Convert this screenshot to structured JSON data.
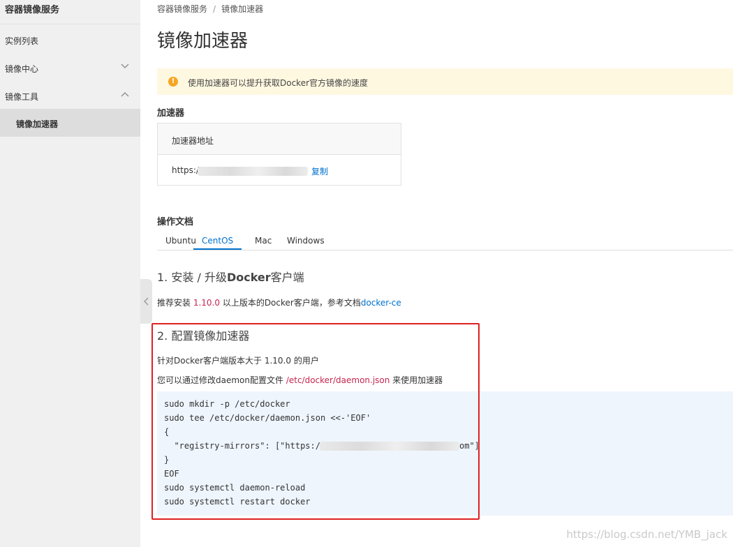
{
  "sidebar": {
    "title": "容器镜像服务",
    "items": [
      {
        "label": "实例列表"
      },
      {
        "label": "镜像中心",
        "expanded": false
      },
      {
        "label": "镜像工具",
        "expanded": true
      },
      {
        "label": "镜像加速器",
        "active": true
      }
    ]
  },
  "breadcrumb": {
    "root": "容器镜像服务",
    "separator": "/",
    "current": "镜像加速器"
  },
  "page": {
    "title": "镜像加速器"
  },
  "notice": {
    "text": "使用加速器可以提升获取Docker官方镜像的速度",
    "color": "#f5a623"
  },
  "accelerator": {
    "section_title": "加速器",
    "header": "加速器地址",
    "url_prefix": "https:/",
    "copy_label": "复制"
  },
  "docs": {
    "section_title": "操作文档",
    "tabs": [
      "Ubuntu",
      "CentOS",
      "Mac",
      "Windows"
    ],
    "active_tab": "CentOS",
    "step1": {
      "number": "1.",
      "title_pre": "安装 / 升级",
      "title_bold": "Docker",
      "title_post": "客户端",
      "desc_pre": "推荐安装 ",
      "version": "1.10.0",
      "desc_mid": " 以上版本的Docker客户端，参考文档",
      "link": "docker-ce"
    },
    "step2": {
      "title": "2. 配置镜像加速器",
      "line1": "针对Docker客户端版本大于 1.10.0 的用户",
      "line2_pre": "您可以通过修改daemon配置文件 ",
      "path": "/etc/docker/daemon.json",
      "line2_post": " 来使用加速器",
      "code": [
        "sudo mkdir -p /etc/docker",
        "sudo tee /etc/docker/daemon.json <<-'EOF'",
        "{",
        "  \"registry-mirrors\": [\"https:/",
        "}",
        "EOF",
        "sudo systemctl daemon-reload",
        "sudo systemctl restart docker"
      ],
      "code_line4_tail": "om\"]"
    }
  },
  "colors": {
    "accent": "#0070cc",
    "highlight": "#c7254e",
    "annotation_box": "#e02020"
  },
  "watermark": "https://blog.csdn.net/YMB_jack"
}
